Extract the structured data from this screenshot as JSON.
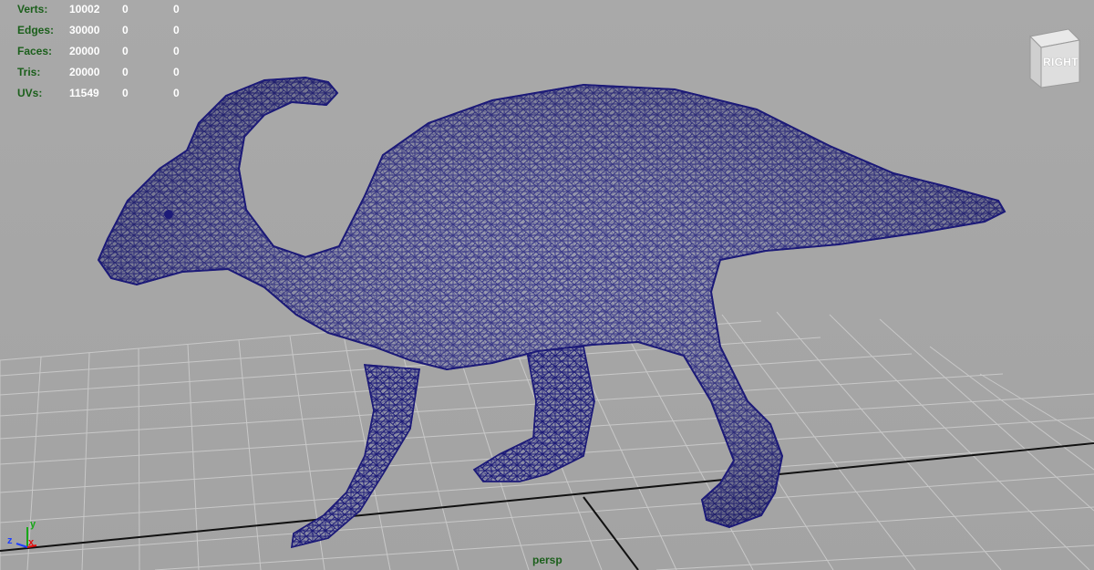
{
  "viewport": {
    "camera": "persp",
    "view_cube_face": "RIGHT"
  },
  "hud": {
    "rows": [
      {
        "label": "Verts:",
        "values": [
          "10002",
          "0",
          "0"
        ]
      },
      {
        "label": "Edges:",
        "values": [
          "30000",
          "0",
          "0"
        ]
      },
      {
        "label": "Faces:",
        "values": [
          "20000",
          "0",
          "0"
        ]
      },
      {
        "label": "Tris:",
        "values": [
          "20000",
          "0",
          "0"
        ]
      },
      {
        "label": "UVs:",
        "values": [
          "11549",
          "0",
          "0"
        ]
      }
    ]
  },
  "axes": {
    "x": "x",
    "y": "y",
    "z": "z"
  },
  "colors": {
    "background": "#a6a6a6",
    "grid": "#c7c7c7",
    "grid_axis": "#111111",
    "wireframe": "#1c1a78",
    "hud_label": "#1b5f1b",
    "hud_value": "#ffffff"
  },
  "model": {
    "icon": "parasaurolophus-wireframe-mesh"
  }
}
